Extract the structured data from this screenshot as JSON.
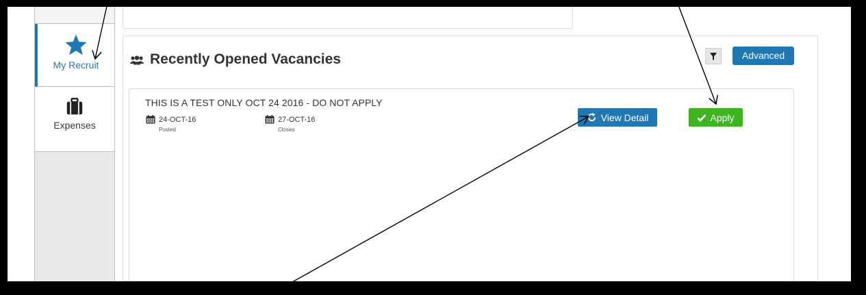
{
  "sidebar": {
    "items": [
      {
        "label": "My Recruit",
        "icon": "star-icon",
        "active": true
      },
      {
        "label": "Expenses",
        "icon": "briefcase-icon",
        "active": false
      }
    ]
  },
  "panel": {
    "title": "Recently Opened Vacancies",
    "title_icon": "users-icon",
    "filter_icon": "filter-icon",
    "advanced_label": "Advanced"
  },
  "vacancy": {
    "title": "THIS IS A TEST ONLY OCT 24 2016 - DO NOT APPLY",
    "posted_date": "24-OCT-16",
    "posted_label": "Posted",
    "closes_date": "27-OCT-16",
    "closes_label": "Closes",
    "view_detail_label": "View Detail",
    "view_detail_icon": "refresh-icon",
    "apply_label": "Apply",
    "apply_icon": "check-icon"
  },
  "colors": {
    "primary": "#1f77b4",
    "success": "#3cb521",
    "frame": "#000000"
  }
}
